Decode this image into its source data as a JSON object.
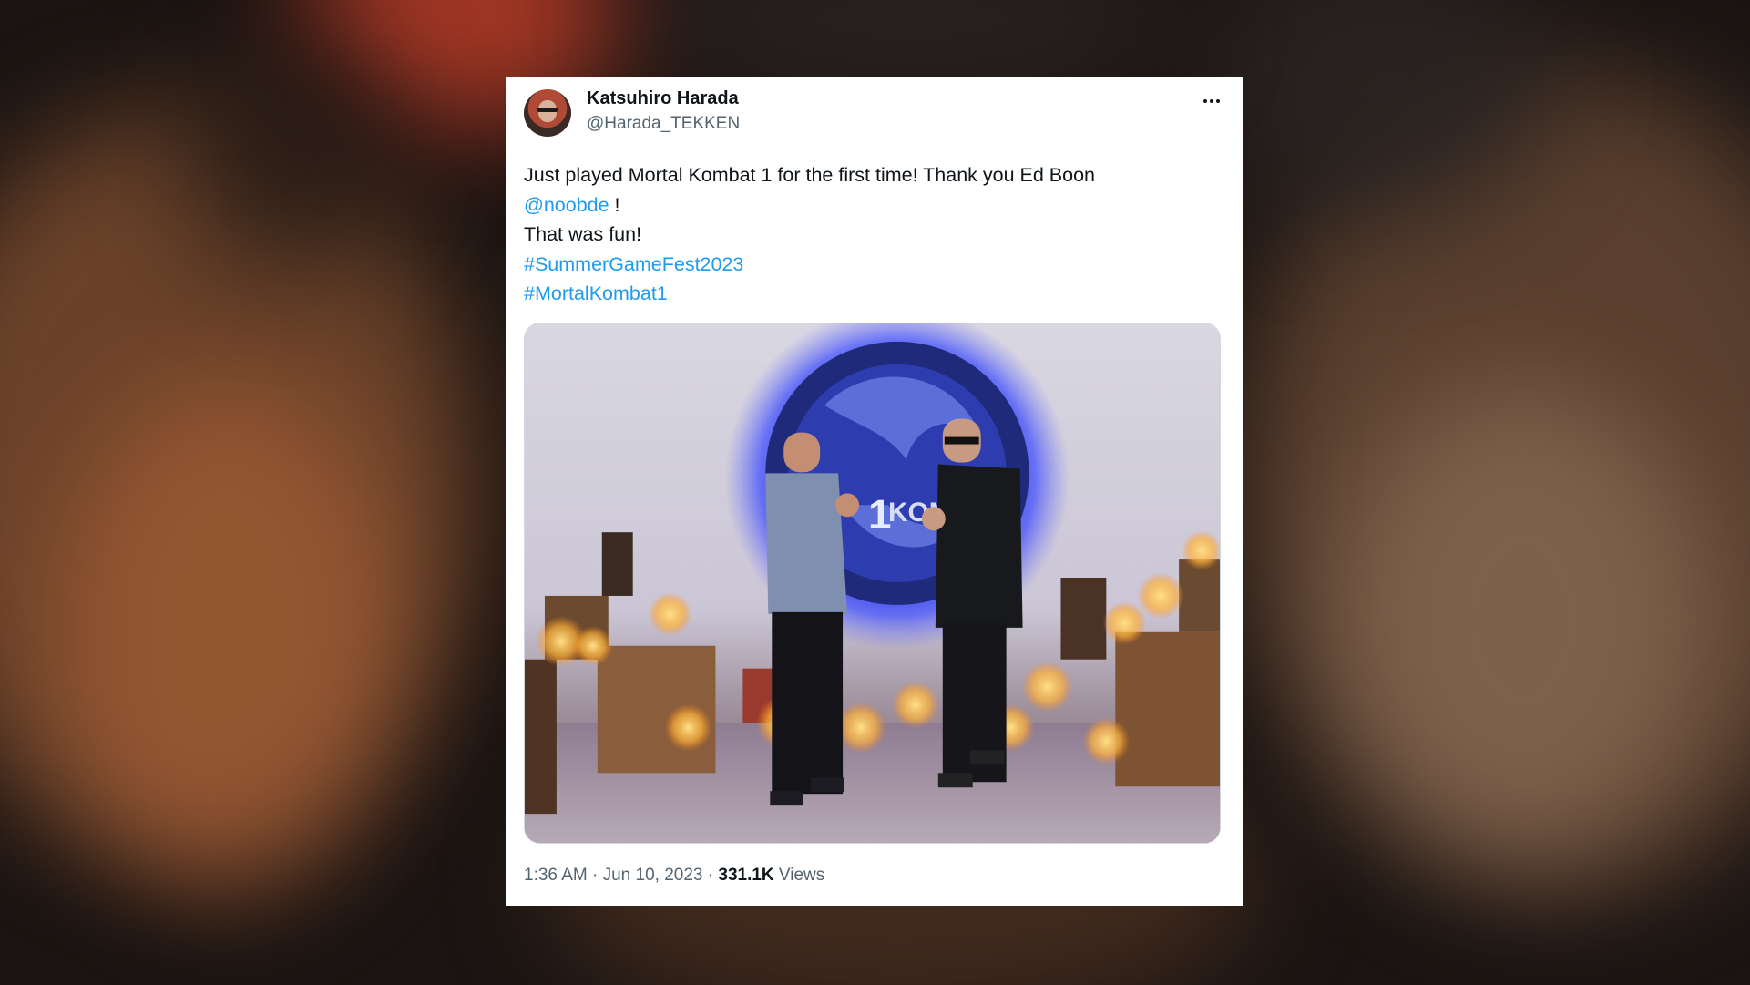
{
  "tweet": {
    "author_name": "Katsuhiro Harada",
    "author_handle": "@Harada_TEKKEN",
    "more_icon": "more-horizontal-icon",
    "text_line1": "Just played Mortal Kombat 1 for the first time! Thank you Ed Boon",
    "mention": "@noobde",
    "mention_suffix": " !",
    "text_line3": "That was fun!",
    "hashtag1": "#SummerGameFest2023",
    "hashtag2": "#MortalKombat1",
    "time": "1:36 AM",
    "date": "Jun 10, 2023",
    "separator": " · ",
    "views_count": "331.1K",
    "views_label": " Views",
    "link_color": "#1d9bf0"
  },
  "photo": {
    "logo_text": "KOMB",
    "logo_numeral": "1"
  }
}
